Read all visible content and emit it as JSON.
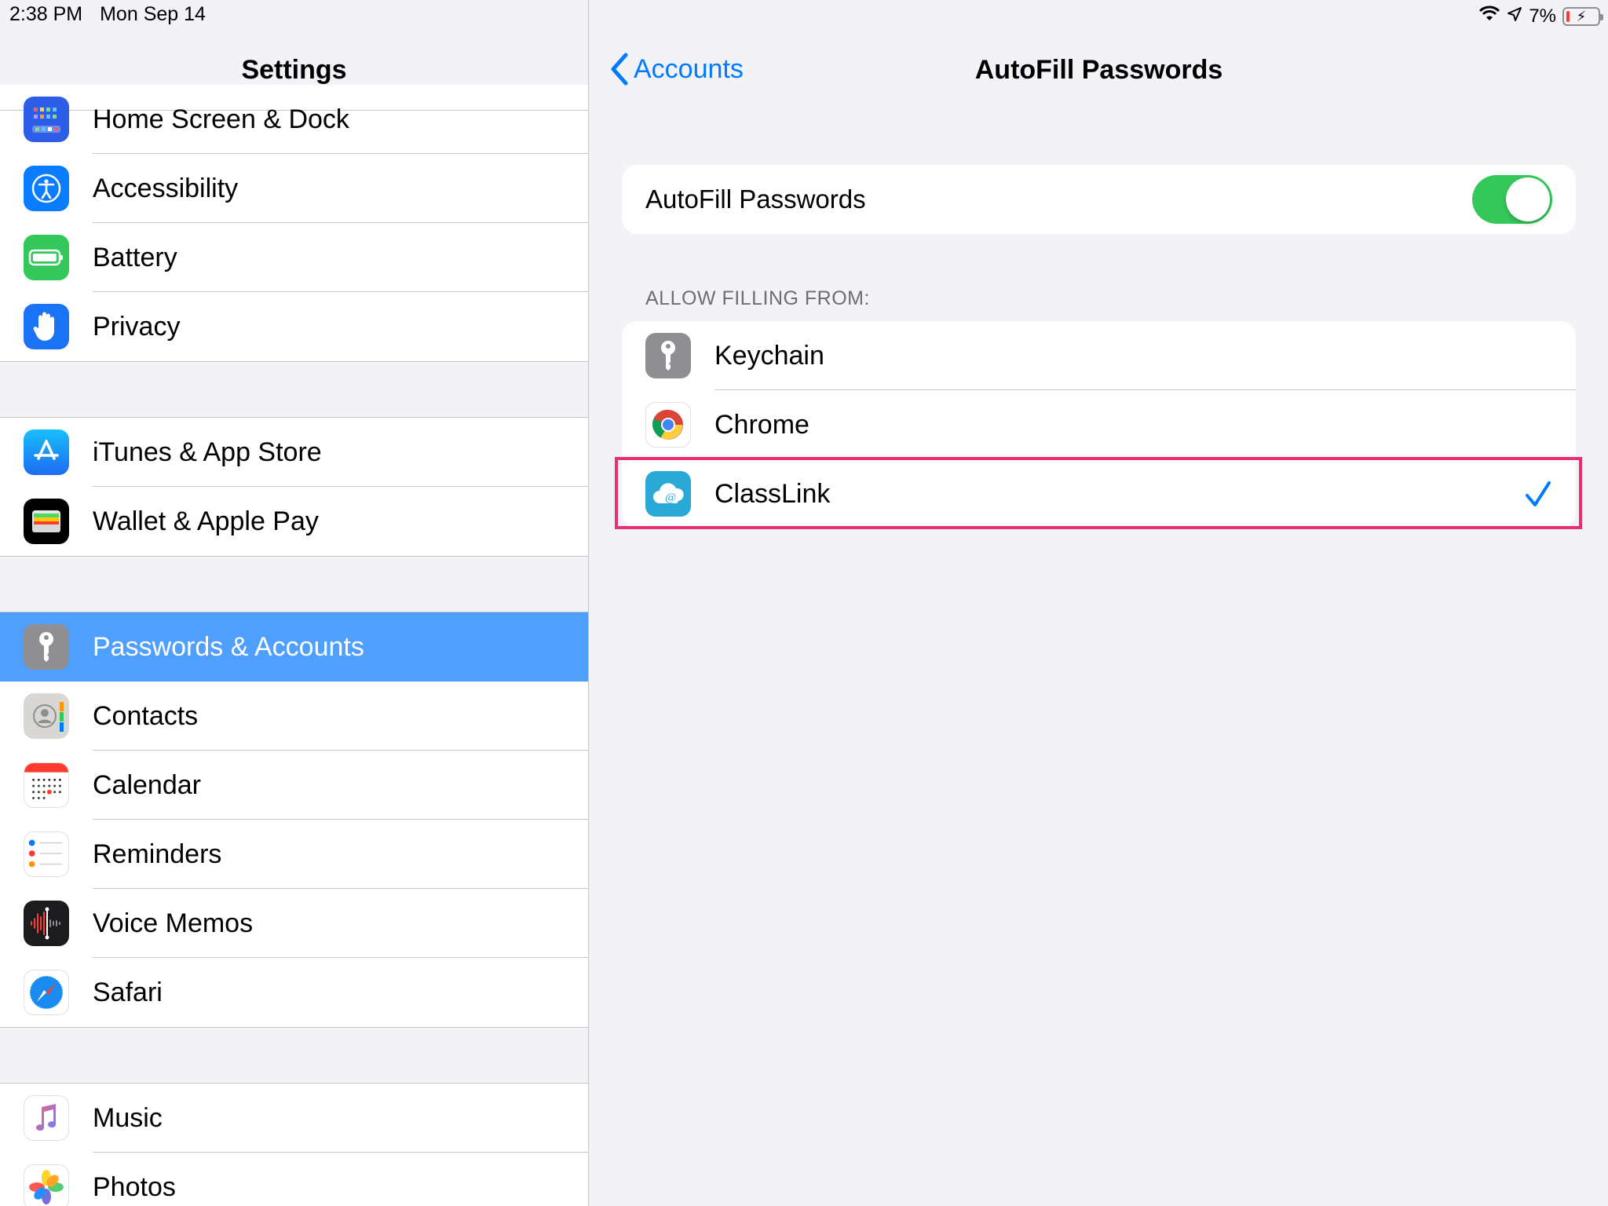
{
  "status_bar": {
    "time": "2:38 PM",
    "date": "Mon Sep 14",
    "battery_percent": "7%",
    "icons": [
      "wifi-icon",
      "location-icon",
      "battery-charging-icon"
    ]
  },
  "sidebar": {
    "title": "Settings",
    "groups": [
      {
        "items": [
          {
            "label": "Home Screen & Dock",
            "icon": "home-screen-icon"
          },
          {
            "label": "Accessibility",
            "icon": "accessibility-icon"
          },
          {
            "label": "Battery",
            "icon": "battery-icon"
          },
          {
            "label": "Privacy",
            "icon": "hand-icon"
          }
        ]
      },
      {
        "items": [
          {
            "label": "iTunes & App Store",
            "icon": "app-store-icon"
          },
          {
            "label": "Wallet & Apple Pay",
            "icon": "wallet-icon"
          }
        ]
      },
      {
        "items": [
          {
            "label": "Passwords & Accounts",
            "icon": "key-icon",
            "selected": true
          },
          {
            "label": "Contacts",
            "icon": "contacts-icon"
          },
          {
            "label": "Calendar",
            "icon": "calendar-icon"
          },
          {
            "label": "Reminders",
            "icon": "reminders-icon"
          },
          {
            "label": "Voice Memos",
            "icon": "voice-memos-icon"
          },
          {
            "label": "Safari",
            "icon": "safari-icon"
          }
        ]
      },
      {
        "items": [
          {
            "label": "Music",
            "icon": "music-icon"
          },
          {
            "label": "Photos",
            "icon": "photos-icon"
          }
        ]
      }
    ]
  },
  "detail": {
    "back_label": "Accounts",
    "title": "AutoFill Passwords",
    "toggle": {
      "label": "AutoFill Passwords",
      "on": true
    },
    "section_header": "ALLOW FILLING FROM:",
    "sources": [
      {
        "label": "Keychain",
        "icon": "keychain-icon",
        "checked": false
      },
      {
        "label": "Chrome",
        "icon": "chrome-icon",
        "checked": false
      },
      {
        "label": "ClassLink",
        "icon": "classlink-icon",
        "checked": true
      }
    ]
  },
  "colors": {
    "accent": "#007aff",
    "selection": "#4f9ffe",
    "toggle_on": "#34c759",
    "highlight": "#e5316f"
  }
}
